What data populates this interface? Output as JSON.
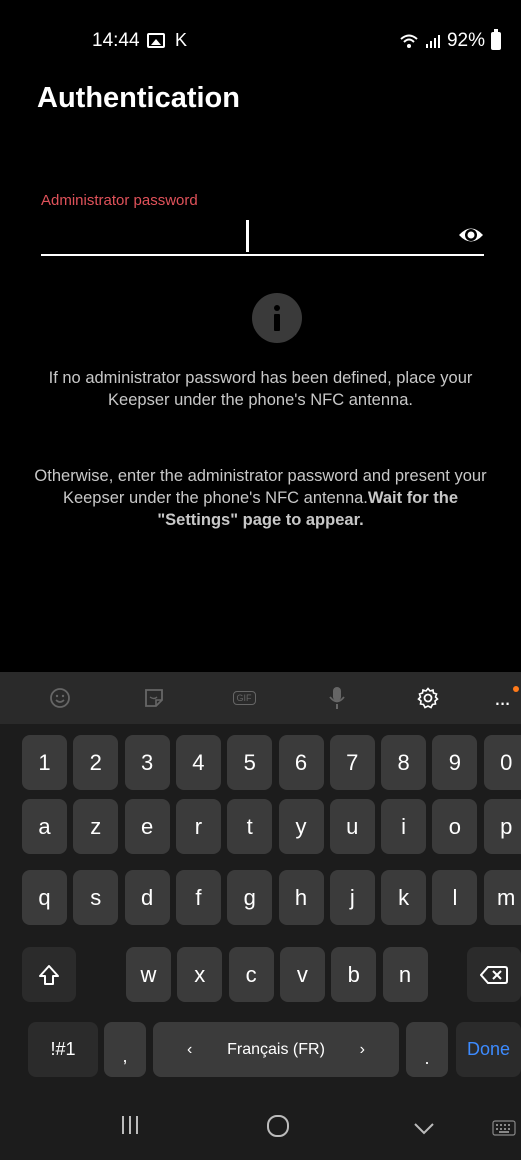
{
  "status": {
    "time": "14:44",
    "notification_k": "K",
    "battery": "92%"
  },
  "header": {
    "title": "Authentication"
  },
  "password_field": {
    "label": "Administrator password",
    "value": ""
  },
  "info": {
    "paragraph1": "If no administrator password has been defined, place your Keepser under the phone's NFC antenna.",
    "paragraph2_plain": "Otherwise, enter the administrator password and present your Keepser under the phone's NFC antenna.",
    "paragraph2_bold": "Wait for the \"Settings\" page to appear."
  },
  "keyboard": {
    "toolbar": [
      "emoji-icon",
      "sticker-icon",
      "gif-icon",
      "mic-icon",
      "settings-gear-icon",
      "more-icon"
    ],
    "gif_label": "GIF",
    "more_label": "...",
    "row_numbers": [
      "1",
      "2",
      "3",
      "4",
      "5",
      "6",
      "7",
      "8",
      "9",
      "0"
    ],
    "row1": [
      "a",
      "z",
      "e",
      "r",
      "t",
      "y",
      "u",
      "i",
      "o",
      "p"
    ],
    "row2": [
      "q",
      "s",
      "d",
      "f",
      "g",
      "h",
      "j",
      "k",
      "l",
      "m"
    ],
    "row3": [
      "w",
      "x",
      "c",
      "v",
      "b",
      "n"
    ],
    "symbols_label": "!#1",
    "comma_label": ",",
    "space_label": "Français (FR)",
    "space_left": "‹",
    "space_right": "›",
    "period_label": ".",
    "done_label": "Done"
  },
  "colors": {
    "accent_label": "#e0525a",
    "done_blue": "#3d8bff",
    "notification_dot": "#ff7a1a"
  }
}
